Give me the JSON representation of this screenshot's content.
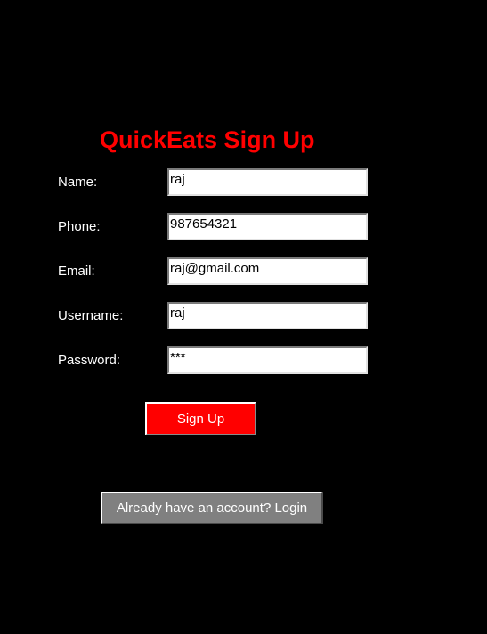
{
  "title": "QuickEats Sign Up",
  "form": {
    "name": {
      "label": "Name:",
      "value": "raj"
    },
    "phone": {
      "label": "Phone:",
      "value": "987654321"
    },
    "email": {
      "label": "Email:",
      "value": "raj@gmail.com"
    },
    "username": {
      "label": "Username:",
      "value": "raj"
    },
    "password": {
      "label": "Password:",
      "value": "***"
    }
  },
  "buttons": {
    "signup_label": "Sign Up",
    "login_label": "Already have an account? Login"
  },
  "colors": {
    "background": "#000000",
    "accent": "#ff0000",
    "secondary_button": "#808080"
  }
}
